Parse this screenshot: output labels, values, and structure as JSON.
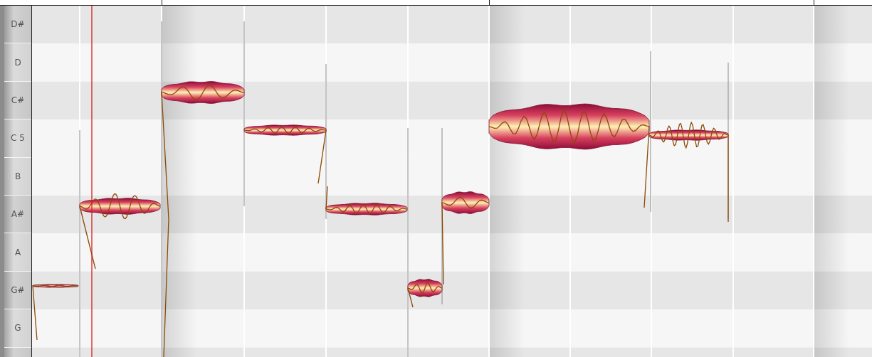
{
  "keys": [
    {
      "label": "D#",
      "kind": "black"
    },
    {
      "label": "D",
      "kind": "white"
    },
    {
      "label": "C#",
      "kind": "black"
    },
    {
      "label": "C 5",
      "kind": "white"
    },
    {
      "label": "B",
      "kind": "white"
    },
    {
      "label": "A#",
      "kind": "black"
    },
    {
      "label": "A",
      "kind": "white"
    },
    {
      "label": "G#",
      "kind": "black"
    },
    {
      "label": "G",
      "kind": "white"
    },
    {
      "kind": "black"
    }
  ]
}
